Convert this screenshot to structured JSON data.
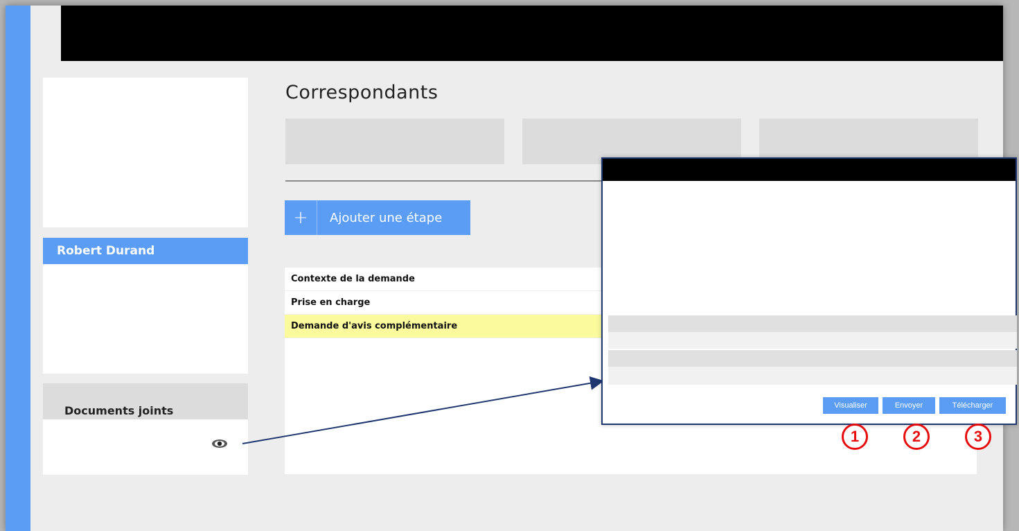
{
  "page": {
    "title": "Correspondants",
    "accent_color": "#5b9cf4",
    "highlight_color": "#fbfb9e",
    "annotation_color": "#e80d0d"
  },
  "sidebar": {
    "person_name": "Robert Durand",
    "documents_title": "Documents joints",
    "documents_icon": "eye-icon"
  },
  "main": {
    "add_step_icon": "plus-icon",
    "add_step_label": "Ajouter une étape",
    "steps": [
      {
        "label": "Contexte de la demande",
        "highlighted": false
      },
      {
        "label": "Prise en charge",
        "highlighted": false
      },
      {
        "label": "Demande d'avis complémentaire",
        "highlighted": true
      }
    ]
  },
  "modal": {
    "buttons": {
      "view": "Visualiser",
      "send": "Envoyer",
      "download": "Télécharger"
    },
    "badges": [
      "1",
      "2",
      "3"
    ]
  }
}
